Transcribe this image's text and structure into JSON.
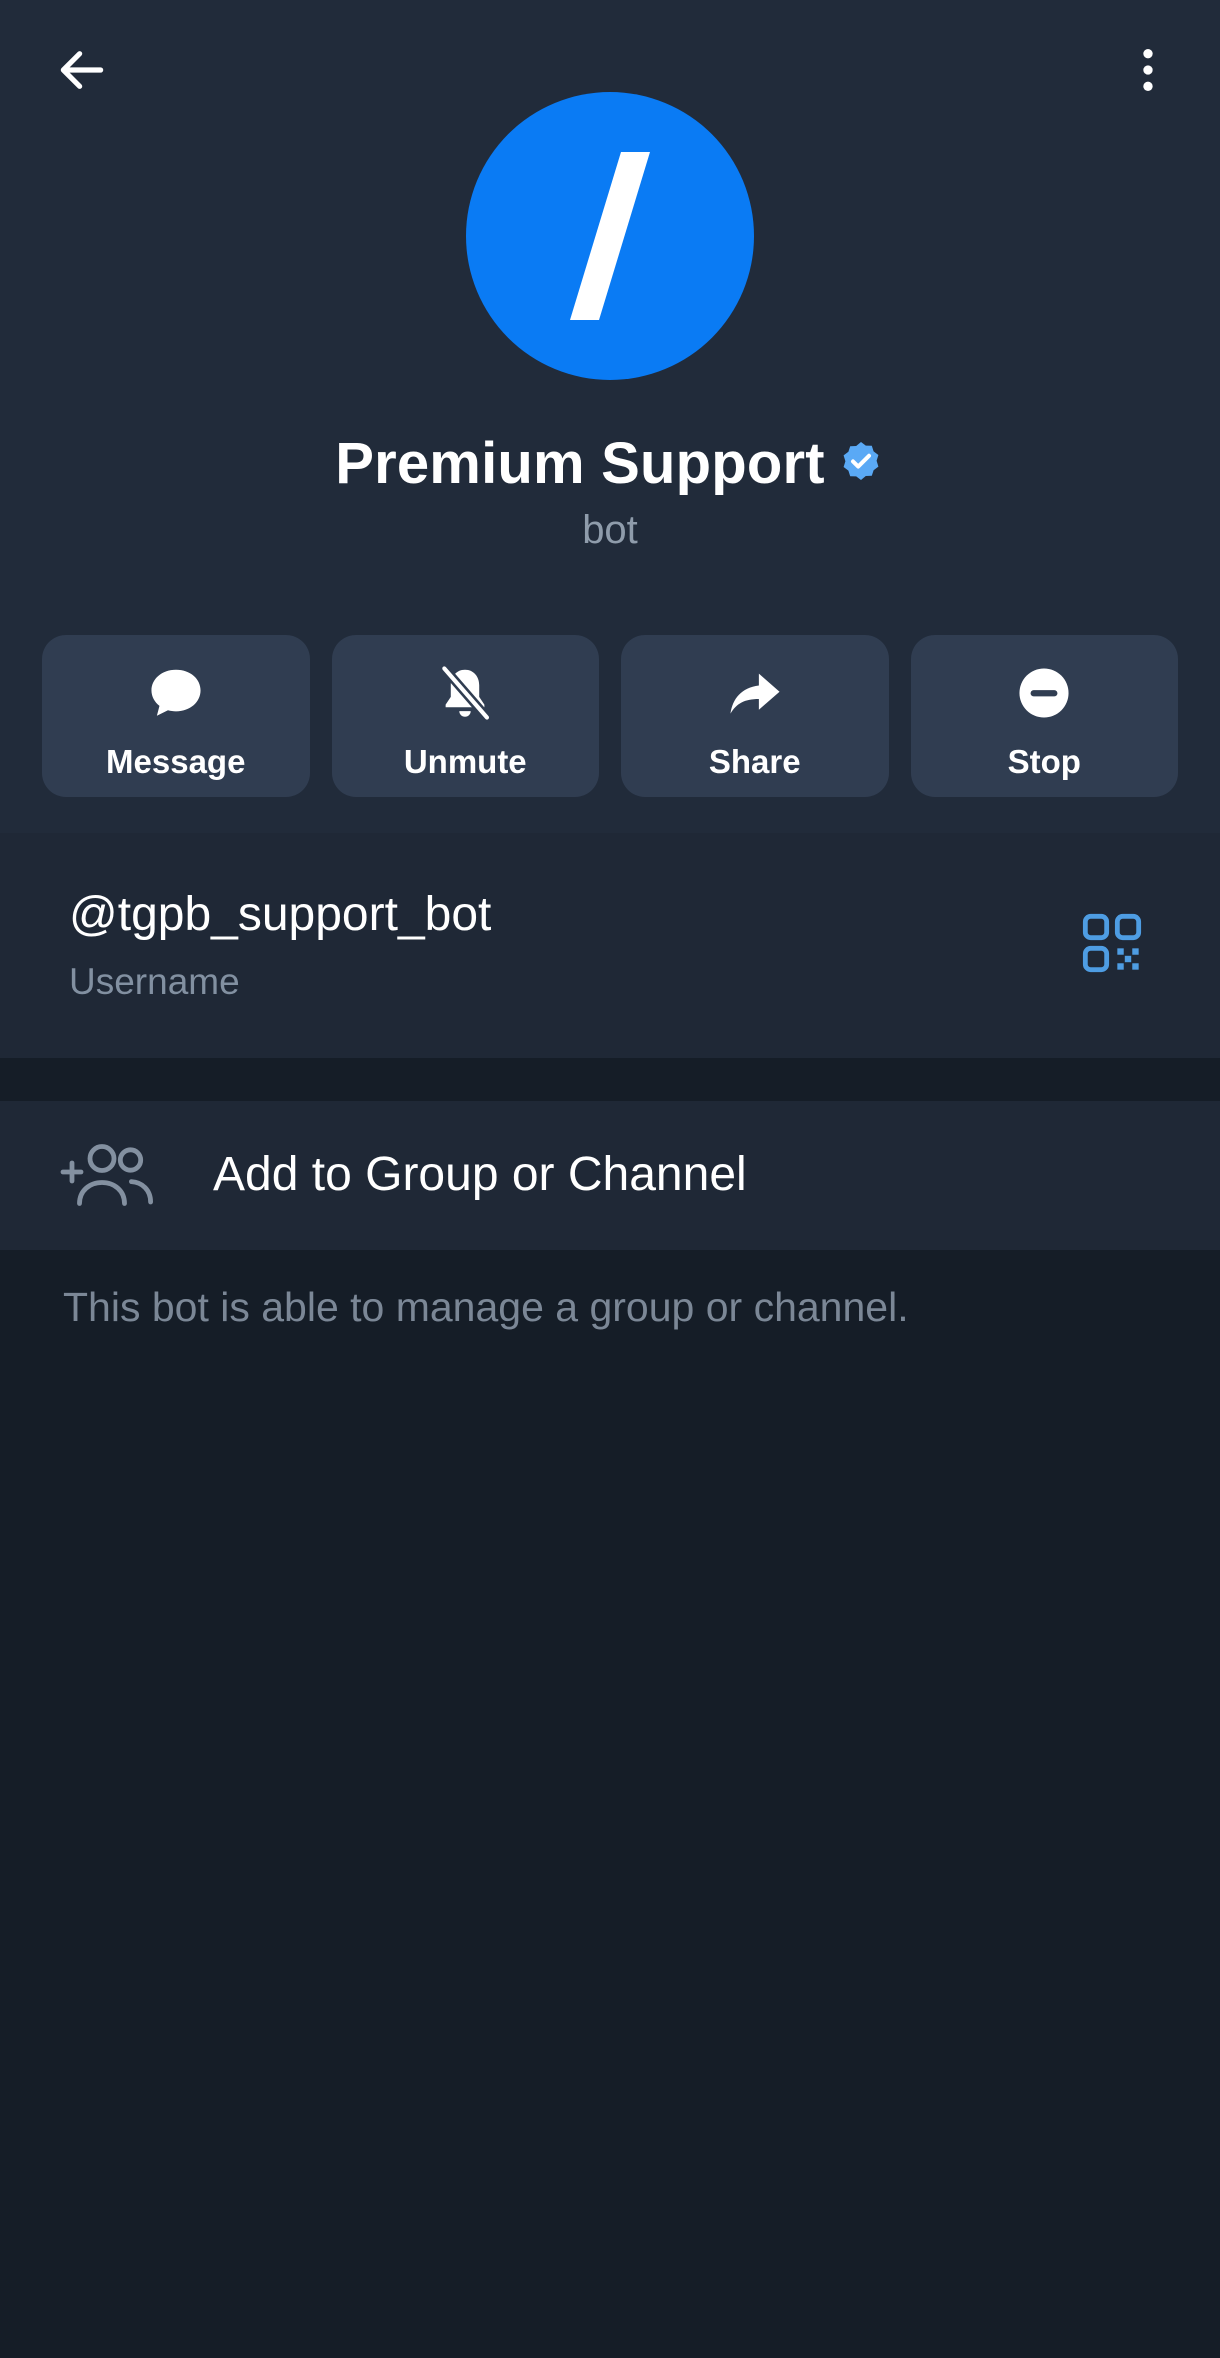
{
  "profile": {
    "name": "Premium Support",
    "subtitle": "bot",
    "verified_color": "#5aa9f5",
    "avatar_color": "#0a7bf4",
    "avatar_glyph": "/"
  },
  "toolbar": {
    "back_icon": "arrow-left-icon",
    "more_icon": "more-vertical-icon"
  },
  "actions": [
    {
      "label": "Message",
      "icon": "message-icon"
    },
    {
      "label": "Unmute",
      "icon": "bell-off-icon"
    },
    {
      "label": "Share",
      "icon": "share-icon"
    },
    {
      "label": "Stop",
      "icon": "stop-icon"
    }
  ],
  "username": {
    "value": "@tgpb_support_bot",
    "label": "Username",
    "qr_icon": "qr-code-icon",
    "accent": "#4e9de3"
  },
  "add_to_group": {
    "label": "Add to Group or Channel",
    "icon": "add-people-icon"
  },
  "hint": "This bot is able to manage a group or channel."
}
